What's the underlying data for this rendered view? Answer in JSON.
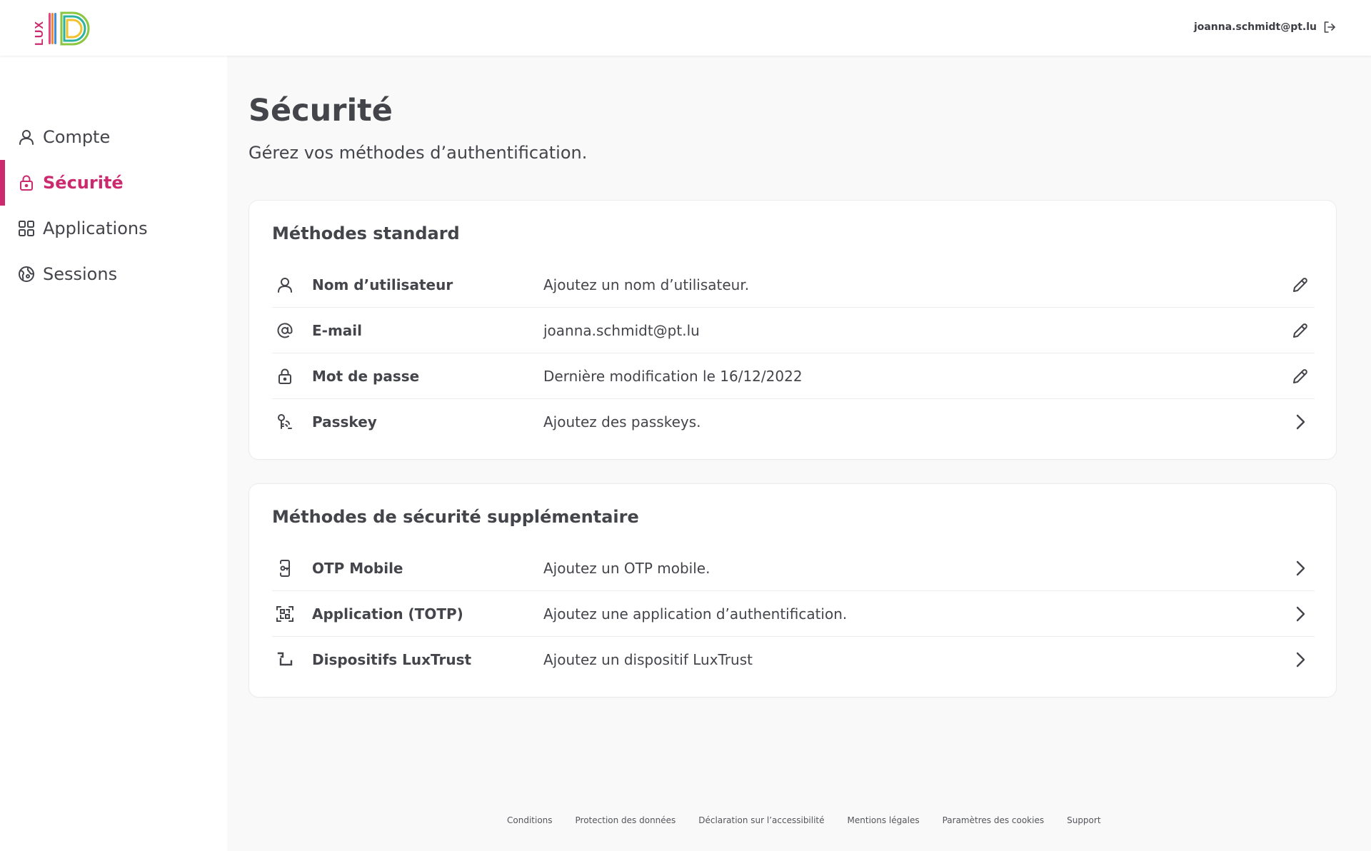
{
  "header": {
    "logo_text": "LUX ID",
    "user_email": "joanna.schmidt@pt.lu",
    "logout_icon": "logout-icon"
  },
  "colors": {
    "accent": "#cc2a6e",
    "text": "#44454b",
    "background": "#f9f9f9",
    "card": "#ffffff"
  },
  "sidebar": {
    "items": [
      {
        "label": "Compte",
        "icon": "user-icon",
        "active": false
      },
      {
        "label": "Sécurité",
        "icon": "lock-icon",
        "active": true
      },
      {
        "label": "Applications",
        "icon": "grid-icon",
        "active": false
      },
      {
        "label": "Sessions",
        "icon": "globe-icon",
        "active": false
      }
    ]
  },
  "main": {
    "title": "Sécurité",
    "subtitle": "Gérez vos méthodes d’authentification.",
    "standard": {
      "title": "Méthodes standard",
      "rows": [
        {
          "label": "Nom d’utilisateur",
          "value": "Ajoutez un nom d’utilisateur.",
          "icon": "user-icon",
          "action": "edit-icon"
        },
        {
          "label": "E-mail",
          "value": "joanna.schmidt@pt.lu",
          "icon": "at-icon",
          "action": "edit-icon"
        },
        {
          "label": "Mot de passe",
          "value": "Dernière modification le 16/12/2022",
          "icon": "lock-icon",
          "action": "edit-icon"
        },
        {
          "label": "Passkey",
          "value": "Ajoutez des passkeys.",
          "icon": "passkey-icon",
          "action": "chevron-right-icon"
        }
      ]
    },
    "additional": {
      "title": "Méthodes de sécurité supplémentaire",
      "rows": [
        {
          "label": "OTP Mobile",
          "value": "Ajoutez un OTP mobile.",
          "icon": "mobile-key-icon",
          "action": "chevron-right-icon"
        },
        {
          "label": "Application (TOTP)",
          "value": "Ajoutez une application d’authentification.",
          "icon": "qr-scan-icon",
          "action": "chevron-right-icon"
        },
        {
          "label": "Dispositifs LuxTrust",
          "value": "Ajoutez un dispositif LuxTrust",
          "icon": "luxtrust-icon",
          "action": "chevron-right-icon"
        }
      ]
    }
  },
  "footer": {
    "links": [
      "Conditions",
      "Protection des données",
      "Déclaration sur  l’accessibilité",
      "Mentions légales",
      "Paramètres des cookies",
      "Support"
    ]
  }
}
